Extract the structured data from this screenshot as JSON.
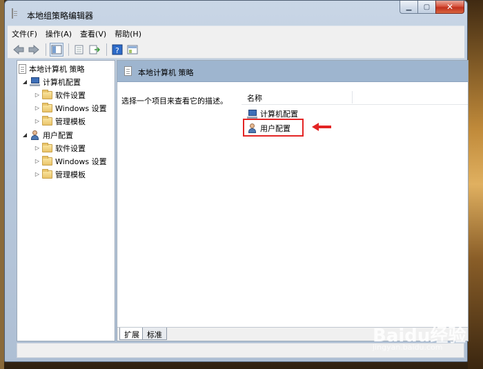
{
  "window": {
    "title": "本地组策略编辑器"
  },
  "menubar": {
    "items": [
      "文件(F)",
      "操作(A)",
      "查看(V)",
      "帮助(H)"
    ]
  },
  "tree": {
    "root": "本地计算机 策略",
    "computer_config": "计算机配置",
    "user_config": "用户配置",
    "software_settings": "软件设置",
    "windows_settings": "Windows 设置",
    "admin_templates": "管理模板"
  },
  "rightpane": {
    "title": "本地计算机 策略",
    "description": "选择一个项目来查看它的描述。",
    "column_name": "名称",
    "rows": [
      "计算机配置",
      "用户配置"
    ]
  },
  "tabs": {
    "extended": "扩展",
    "standard": "标准"
  },
  "watermark": {
    "main": "Baidu经验",
    "sub": "jingyan.baidu.com"
  },
  "colors": {
    "highlight": "#e32424",
    "pane_header": "#9eb5cf"
  }
}
